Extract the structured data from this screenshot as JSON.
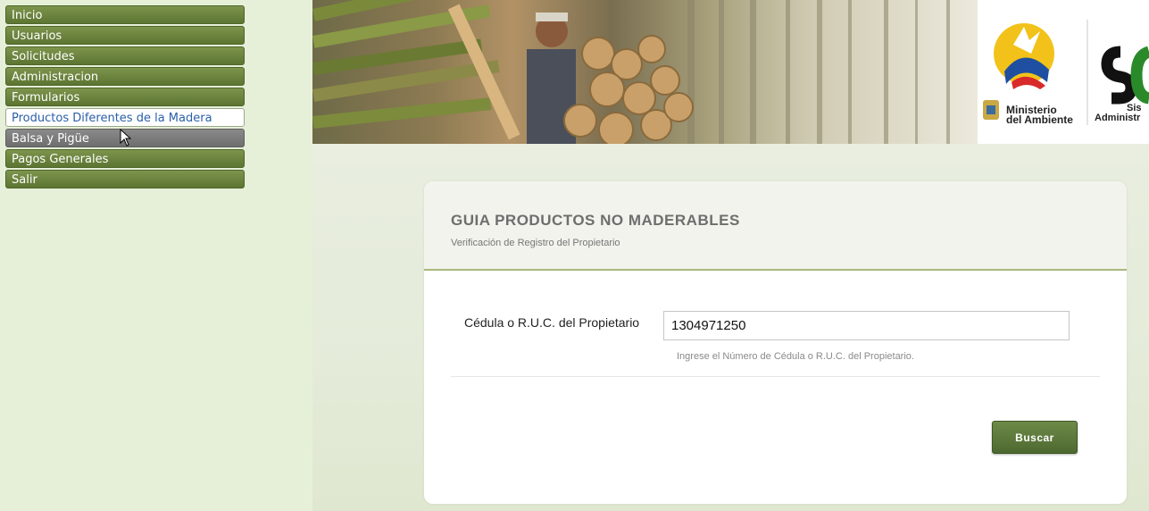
{
  "sidebar": {
    "items": [
      {
        "label": "Inicio",
        "state": "normal"
      },
      {
        "label": "Usuarios",
        "state": "normal"
      },
      {
        "label": "Solicitudes",
        "state": "normal"
      },
      {
        "label": "Administracion",
        "state": "normal"
      },
      {
        "label": "Formularios",
        "state": "normal"
      },
      {
        "label": "Productos Diferentes de la Madera",
        "state": "active"
      },
      {
        "label": "Balsa y Pigüe",
        "state": "hover"
      },
      {
        "label": "Pagos Generales",
        "state": "normal"
      },
      {
        "label": "Salir",
        "state": "normal"
      }
    ]
  },
  "banner": {
    "ministry_line1": "Ministerio",
    "ministry_line2": "del Ambiente",
    "system_partial_1": "Sis",
    "system_partial_2": "Administr"
  },
  "panel": {
    "title": "GUIA PRODUCTOS NO MADERABLES",
    "subtitle": "Verificación de Registro del Propietario",
    "field_label": "Cédula o R.U.C. del Propietario",
    "field_value": "1304971250",
    "help_text": "Ingrese el Número de Cédula o R.U.C. del Propietario.",
    "button_label": "Buscar"
  },
  "colors": {
    "menu_green": "#6b8340",
    "active_text": "#2a5ea8",
    "button_green": "#5a7639"
  }
}
